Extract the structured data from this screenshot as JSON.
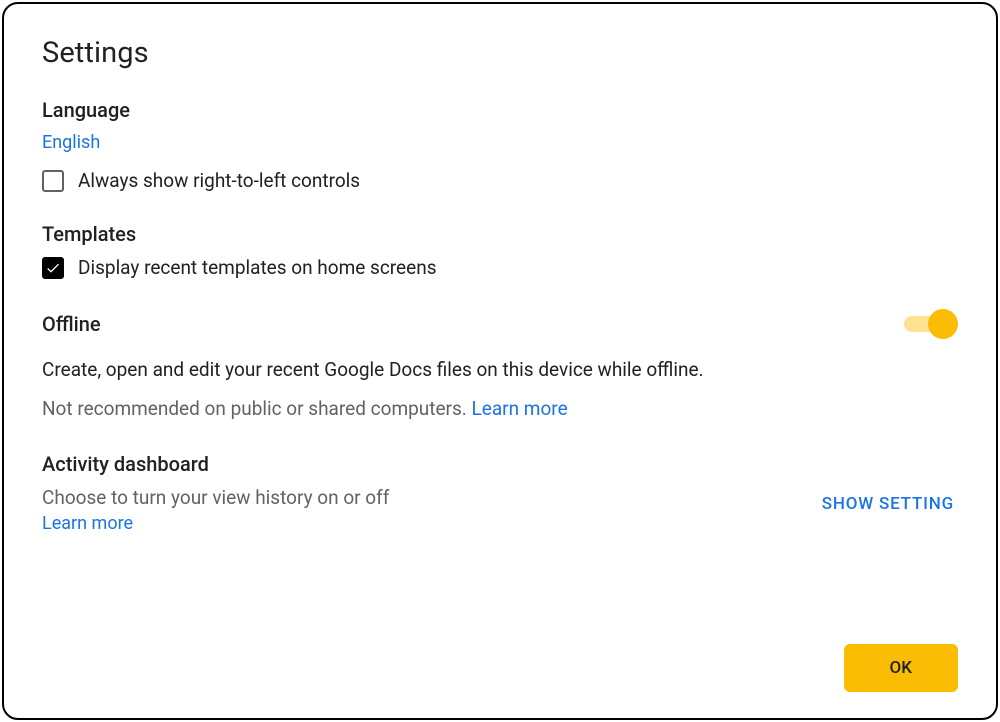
{
  "dialog": {
    "title": "Settings"
  },
  "language": {
    "header": "Language",
    "current": "English",
    "rtl_checkbox": {
      "label": "Always show right-to-left controls",
      "checked": false
    }
  },
  "templates": {
    "header": "Templates",
    "recent_checkbox": {
      "label": "Display recent templates on home screens",
      "checked": true
    }
  },
  "offline": {
    "header": "Offline",
    "toggle_on": true,
    "description": "Create, open and edit your recent Google Docs files on this device while offline.",
    "warning": "Not recommended on public or shared computers. ",
    "learn_more": "Learn more"
  },
  "activity": {
    "header": "Activity dashboard",
    "description": "Choose to turn your view history on or off",
    "learn_more": "Learn more",
    "show_setting": "SHOW SETTING"
  },
  "footer": {
    "ok": "OK"
  }
}
